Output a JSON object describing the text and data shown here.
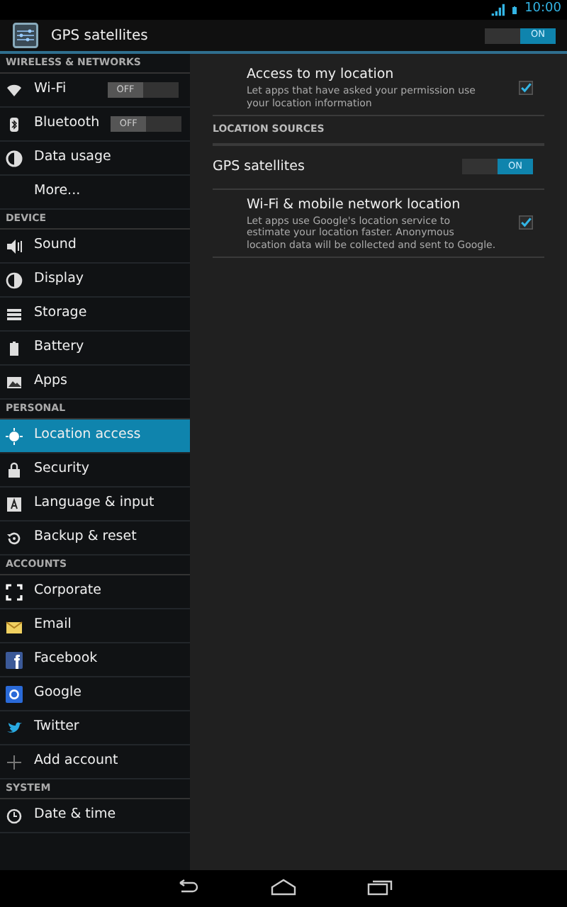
{
  "status_bar": {
    "time": "10:00"
  },
  "action_bar": {
    "title": "GPS satellites",
    "switch": {
      "label": "ON",
      "on": true
    }
  },
  "sidebar": {
    "sections": [
      {
        "title": "WIRELESS & NETWORKS",
        "items": [
          {
            "label": "Wi-Fi",
            "selected": false,
            "switch": {
              "label": "OFF",
              "on": false
            }
          },
          {
            "label": "Bluetooth",
            "selected": false,
            "switch": {
              "label": "OFF",
              "on": false
            }
          },
          {
            "label": "Data usage",
            "selected": false
          },
          {
            "label": "More...",
            "selected": false
          }
        ]
      },
      {
        "title": "DEVICE",
        "items": [
          {
            "label": "Sound",
            "selected": false
          },
          {
            "label": "Display",
            "selected": false
          },
          {
            "label": "Storage",
            "selected": false
          },
          {
            "label": "Battery",
            "selected": false
          },
          {
            "label": "Apps",
            "selected": false
          }
        ]
      },
      {
        "title": "PERSONAL",
        "items": [
          {
            "label": "Location access",
            "selected": true
          },
          {
            "label": "Security",
            "selected": false
          },
          {
            "label": "Language & input",
            "selected": false
          },
          {
            "label": "Backup & reset",
            "selected": false
          }
        ]
      },
      {
        "title": "ACCOUNTS",
        "items": [
          {
            "label": "Corporate",
            "selected": false
          },
          {
            "label": "Email",
            "selected": false
          },
          {
            "label": "Facebook",
            "selected": false
          },
          {
            "label": "Google",
            "selected": false
          },
          {
            "label": "Twitter",
            "selected": false
          },
          {
            "label": "Add account",
            "selected": false
          }
        ]
      },
      {
        "title": "SYSTEM",
        "items": [
          {
            "label": "Date & time",
            "selected": false
          }
        ]
      }
    ]
  },
  "settings": [
    {
      "kind": "check",
      "title": "Access to my location",
      "summary": "Let apps that have asked your permission use your location information",
      "checked": true
    },
    {
      "kind": "header",
      "title": "LOCATION SOURCES"
    },
    {
      "kind": "switch",
      "title": "GPS satellites",
      "switch": {
        "label": "ON",
        "on": true
      }
    },
    {
      "kind": "check",
      "title": "Wi-Fi & mobile network location",
      "summary": "Let apps use Google's location service to estimate your location faster. Anonymous location data will be collected and sent to Google.",
      "checked": true
    }
  ]
}
